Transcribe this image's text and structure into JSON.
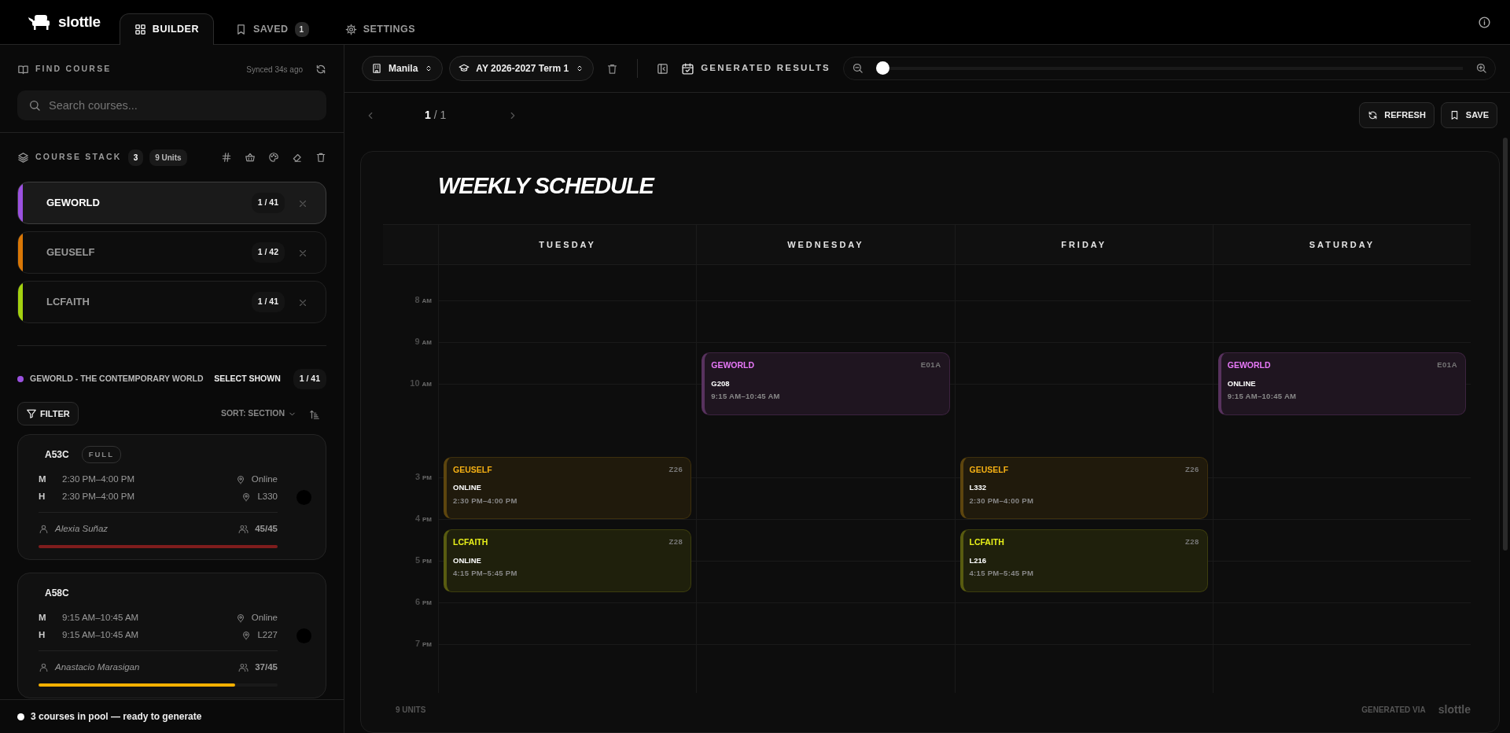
{
  "app": {
    "logo": "slottle"
  },
  "tabs": [
    {
      "label": "BUILDER",
      "selected": true
    },
    {
      "label": "SAVED",
      "badge": "1",
      "selected": false
    },
    {
      "label": "SETTINGS",
      "selected": false
    }
  ],
  "find_course": {
    "title": "FIND COURSE",
    "synced": "Synced 34s ago",
    "search": {
      "placeholder": "Search courses..."
    }
  },
  "course_stack": {
    "title": "COURSE STACK",
    "count": "3",
    "units": "9 Units",
    "items": [
      {
        "code": "GEWORLD",
        "count": "1 / 41",
        "color": "#9b51e0",
        "selected": true
      },
      {
        "code": "GEUSELF",
        "count": "1 / 42",
        "color": "#d97706",
        "selected": false
      },
      {
        "code": "LCFAITH",
        "count": "1 / 41",
        "color": "#a3d10f",
        "selected": false
      }
    ]
  },
  "course_detail": {
    "title": "GEWORLD - THE CONTEMPORARY WORLD",
    "color": "#9b51e0",
    "select_shown": "SELECT SHOWN",
    "count": "1 / 41",
    "filter": "FILTER",
    "sort": "SORT: SECTION",
    "sections": [
      {
        "code": "A53C",
        "full": true,
        "badge": "FULL",
        "selected": false,
        "meetings": [
          {
            "day": "M",
            "time": "2:30 PM–4:00 PM",
            "location": "Online"
          },
          {
            "day": "H",
            "time": "2:30 PM–4:00 PM",
            "location": "L330"
          }
        ],
        "instructor": "Alexia Suñaz",
        "enrolled": "45/45",
        "level": 1.0
      },
      {
        "code": "A58C",
        "full": false,
        "selected": false,
        "meetings": [
          {
            "day": "M",
            "time": "9:15 AM–10:45 AM",
            "location": "Online"
          },
          {
            "day": "H",
            "time": "9:15 AM–10:45 AM",
            "location": "L227"
          }
        ],
        "instructor": "Anastacio Marasigan",
        "enrolled": "37/45",
        "level": 0.822
      }
    ]
  },
  "status_bar": {
    "text": "3 courses in pool — ready to generate"
  },
  "toolbar": {
    "campus": "Manila",
    "term": "AY 2026-2027 Term 1",
    "results_title": "GENERATED RESULTS",
    "zoom": {
      "level": 0
    }
  },
  "pager": {
    "current": "1",
    "total": "/ 1"
  },
  "actions": [
    {
      "kind": "refresh",
      "label": "REFRESH"
    },
    {
      "kind": "save",
      "label": "SAVE"
    }
  ],
  "schedule": {
    "title": "WEEKLY SCHEDULE",
    "hours": [
      {
        "hour": "8",
        "period": "AM"
      },
      {
        "hour": "9",
        "period": "AM"
      },
      {
        "hour": "10",
        "period": "AM"
      },
      {
        "hour": "3",
        "period": "PM"
      },
      {
        "hour": "4",
        "period": "PM"
      },
      {
        "hour": "5",
        "period": "PM"
      },
      {
        "hour": "6",
        "period": "PM"
      },
      {
        "hour": "7",
        "period": "PM"
      }
    ],
    "days": [
      {
        "name": "TUESDAY",
        "events": [
          {
            "code": "GEUSELF",
            "section": "Z26",
            "room": "ONLINE",
            "time": "2:30 PM–4:00 PM",
            "color": "#f5b014"
          },
          {
            "code": "LCFAITH",
            "section": "Z28",
            "room": "ONLINE",
            "time": "4:15 PM–5:45 PM",
            "color": "#e8f01a"
          }
        ]
      },
      {
        "name": "WEDNESDAY",
        "events": [
          {
            "code": "GEWORLD",
            "section": "E01A",
            "room": "G208",
            "time": "9:15 AM–10:45 AM",
            "color": "#e879f9"
          }
        ]
      },
      {
        "name": "FRIDAY",
        "events": [
          {
            "code": "GEUSELF",
            "section": "Z26",
            "room": "L332",
            "time": "2:30 PM–4:00 PM",
            "color": "#f5b014"
          },
          {
            "code": "LCFAITH",
            "section": "Z28",
            "room": "L216",
            "time": "4:15 PM–5:45 PM",
            "color": "#e8f01a"
          }
        ]
      },
      {
        "name": "SATURDAY",
        "events": [
          {
            "code": "GEWORLD",
            "section": "E01A",
            "room": "ONLINE",
            "time": "9:15 AM–10:45 AM",
            "color": "#e879f9"
          }
        ]
      }
    ],
    "footer_units": "9 UNITS",
    "footer_credit": "GENERATED VIA",
    "footer_logo": "slottle"
  }
}
